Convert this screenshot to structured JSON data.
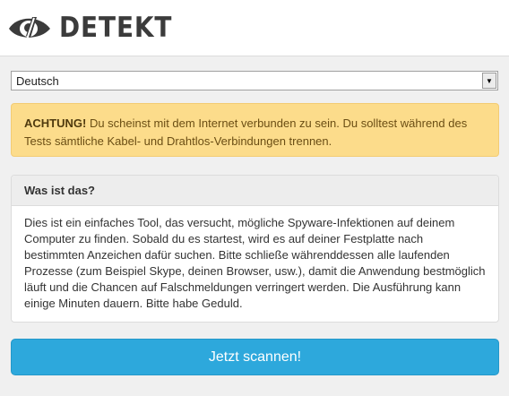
{
  "header": {
    "logo_text": "DETEKT",
    "logo_icon": "eye-icon"
  },
  "language_select": {
    "value": "Deutsch",
    "arrow_icon": "triangle-down-icon"
  },
  "alert": {
    "strong": "ACHTUNG!",
    "text": " Du scheinst mit dem Internet verbunden zu sein. Du solltest während des Tests sämtliche Kabel- und Drahtlos-Verbindungen trennen."
  },
  "info_panel": {
    "title": "Was ist das?",
    "body": "Dies ist ein einfaches Tool, das versucht, mögliche Spyware-Infektionen auf deinem Computer zu finden. Sobald du es startest, wird es auf deiner Festplatte nach bestimmten Anzeichen dafür suchen. Bitte schließe währenddessen alle laufenden Prozesse (zum Beispiel Skype, deinen Browser, usw.), damit die Anwendung bestmöglich läuft und die Chancen auf Falschmeldungen verringert werden. Die Ausführung kann einige Minuten dauern. Bitte habe Geduld."
  },
  "scan_button": {
    "label": "Jetzt scannen!"
  },
  "colors": {
    "accent": "#2da8dc",
    "warning_bg": "#fcdc8b",
    "logo": "#3b3b3b"
  }
}
